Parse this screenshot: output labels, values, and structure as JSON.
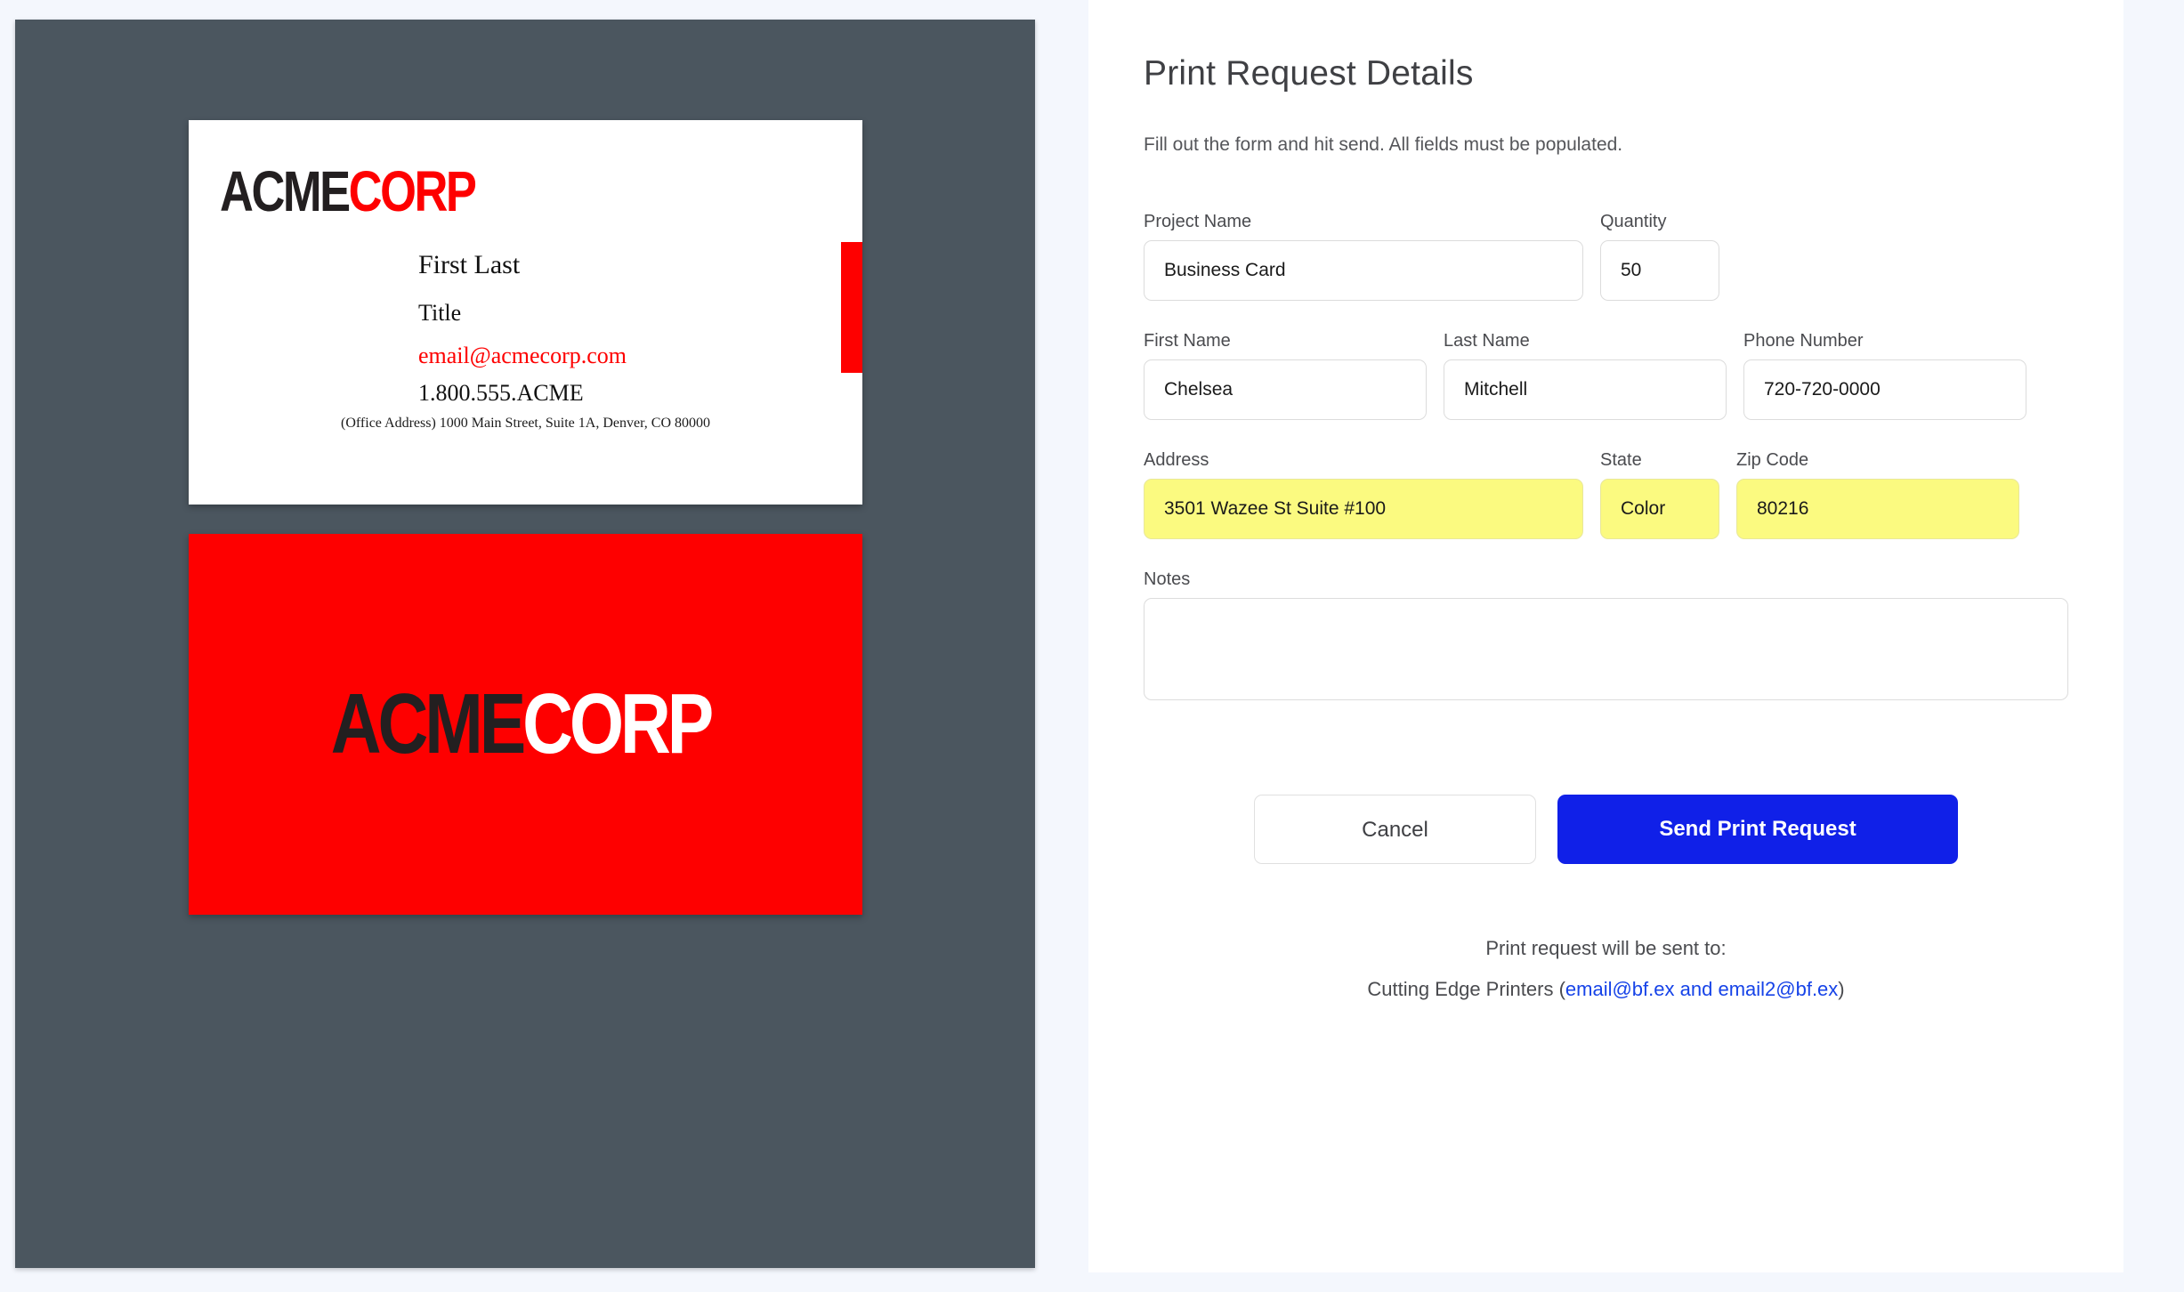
{
  "colors": {
    "page_background": "#f4f7fd",
    "preview_background": "#4b565f",
    "brand_red": "#fe0000",
    "brand_dark": "#231f20",
    "accent_blue": "#1020e8",
    "highlight_yellow": "#fbfa80",
    "link_blue": "#1643e8"
  },
  "preview": {
    "front_card": {
      "logo": {
        "part1": "ACME",
        "part2": "CORP"
      },
      "name": "First Last",
      "title": "Title",
      "email": "email@acmecorp.com",
      "phone": "1.800.555.ACME",
      "address": "(Office Address) 1000 Main Street, Suite 1A, Denver, CO 80000"
    },
    "back_card": {
      "logo": {
        "part1": "ACME",
        "part2": "CORP"
      }
    }
  },
  "form": {
    "title": "Print Request Details",
    "subtitle": "Fill out the form and hit send. All fields must be populated.",
    "fields": {
      "project_name": {
        "label": "Project Name",
        "value": "Business Card"
      },
      "quantity": {
        "label": "Quantity",
        "value": "50"
      },
      "first_name": {
        "label": "First Name",
        "value": "Chelsea"
      },
      "last_name": {
        "label": "Last Name",
        "value": "Mitchell"
      },
      "phone_number": {
        "label": "Phone Number",
        "value": "720-720-0000"
      },
      "address": {
        "label": "Address",
        "value": "3501 Wazee St Suite #100"
      },
      "state": {
        "label": "State",
        "value": "Color"
      },
      "zip_code": {
        "label": "Zip Code",
        "value": "80216"
      },
      "notes": {
        "label": "Notes",
        "value": ""
      }
    },
    "buttons": {
      "cancel": "Cancel",
      "send": "Send Print Request"
    },
    "footer": {
      "line1": "Print request will be sent to:",
      "recipient_prefix": "Cutting Edge Printers (",
      "email1": "email@bf.ex",
      "email_joiner": " and ",
      "email2": "email2@bf.ex",
      "recipient_suffix": ")"
    }
  }
}
